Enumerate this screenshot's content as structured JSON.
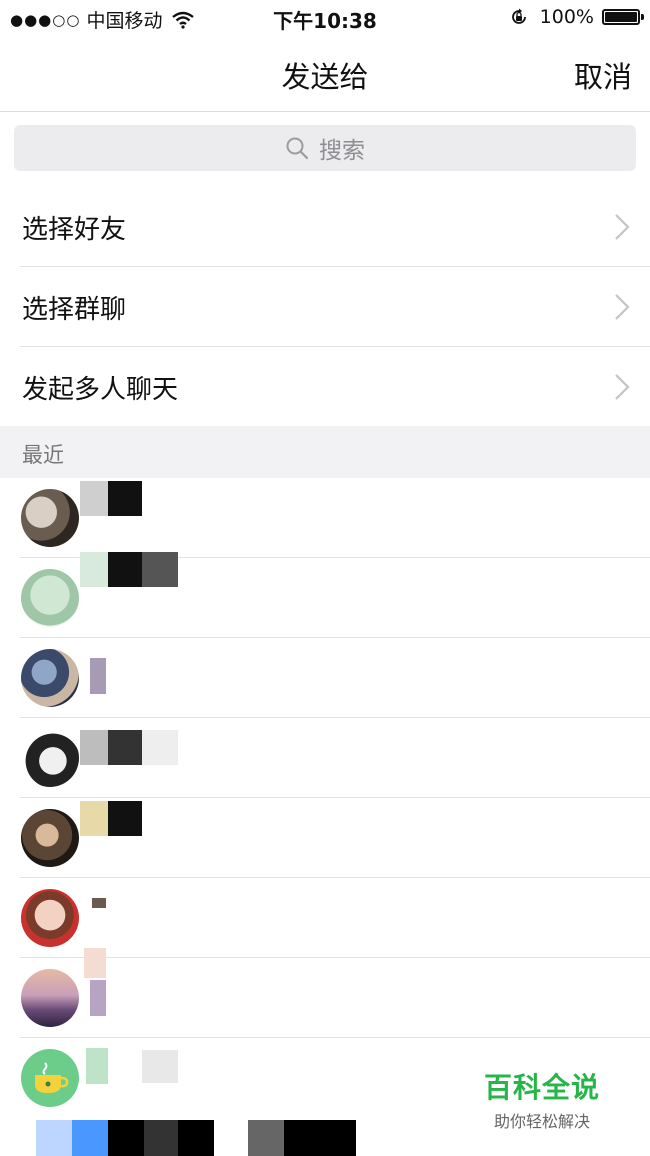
{
  "status_bar": {
    "carrier": "中国移动",
    "time": "下午10:38",
    "battery": "100%"
  },
  "nav": {
    "title": "发送给",
    "cancel": "取消"
  },
  "search": {
    "placeholder": "搜索"
  },
  "menu": [
    {
      "label": "选择好友"
    },
    {
      "label": "选择群聊"
    },
    {
      "label": "发起多人聊天"
    }
  ],
  "section": {
    "recent": "最近"
  },
  "watermark": {
    "title": "百科全说",
    "subtitle": "助你轻松解决"
  },
  "colors": {
    "accent": "#27b54a",
    "divider": "#e3e3e3",
    "section_bg": "#f2f2f4"
  }
}
